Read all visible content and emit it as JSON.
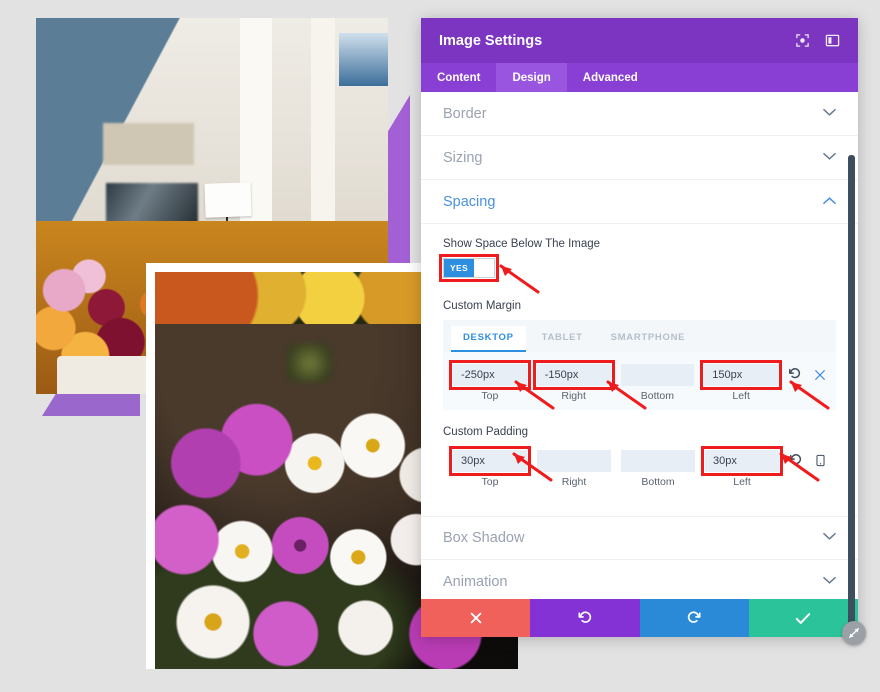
{
  "page": {
    "background_color": "#e2e2e2"
  },
  "canvas": {
    "images": [
      {
        "name": "flower-market-photo",
        "alt": "Blurred flower market stall with orange, yellow and magenta blooms",
        "accent_color": "#a35fd4"
      },
      {
        "name": "cosmos-bouquet-photo",
        "alt": "Close-up of purple and white cosmos flowers on a dark background",
        "border_color": "#ffffff"
      }
    ]
  },
  "modal": {
    "title": "Image Settings",
    "header_icons": [
      {
        "name": "target-focus-icon"
      },
      {
        "name": "layout-panel-icon"
      }
    ],
    "tabs": [
      {
        "label": "Content",
        "active": false
      },
      {
        "label": "Design",
        "active": true
      },
      {
        "label": "Advanced",
        "active": false
      }
    ],
    "sections": [
      {
        "label": "Border",
        "open": false,
        "chevron": "down"
      },
      {
        "label": "Sizing",
        "open": false,
        "chevron": "down"
      },
      {
        "label": "Spacing",
        "open": true,
        "chevron": "up"
      },
      {
        "label": "Box Shadow",
        "open": false,
        "chevron": "down"
      },
      {
        "label": "Animation",
        "open": false,
        "chevron": "down"
      }
    ],
    "spacing": {
      "show_space_label": "Show Space Below The Image",
      "toggle": {
        "value": "YES",
        "on": true,
        "highlighted": true
      },
      "custom_margin_label": "Custom Margin",
      "custom_padding_label": "Custom Padding",
      "device_tabs": [
        {
          "label": "DESKTOP",
          "active": true
        },
        {
          "label": "TABLET",
          "active": false
        },
        {
          "label": "SMARTPHONE",
          "active": false
        }
      ],
      "margin": {
        "fields": [
          {
            "caption": "Top",
            "value": "-250px",
            "highlighted": true
          },
          {
            "caption": "Right",
            "value": "-150px",
            "highlighted": true
          },
          {
            "caption": "Bottom",
            "value": "",
            "highlighted": false
          },
          {
            "caption": "Left",
            "value": "150px",
            "highlighted": true
          }
        ],
        "icons": [
          {
            "name": "reset-icon"
          },
          {
            "name": "close-icon"
          }
        ]
      },
      "padding": {
        "fields": [
          {
            "caption": "Top",
            "value": "30px",
            "highlighted": true
          },
          {
            "caption": "Right",
            "value": "",
            "highlighted": false
          },
          {
            "caption": "Bottom",
            "value": "",
            "highlighted": false
          },
          {
            "caption": "Left",
            "value": "30px",
            "highlighted": true
          }
        ],
        "icons": [
          {
            "name": "reset-icon"
          },
          {
            "name": "mobile-device-icon"
          }
        ]
      }
    },
    "footer_buttons": [
      {
        "name": "cancel-button",
        "icon": "close-icon",
        "color": "#f0615c"
      },
      {
        "name": "undo-button",
        "icon": "undo-icon",
        "color": "#8431d6"
      },
      {
        "name": "redo-button",
        "icon": "redo-icon",
        "color": "#2b8ad8"
      },
      {
        "name": "save-button",
        "icon": "check-icon",
        "color": "#2bc49a"
      }
    ],
    "colors": {
      "header": "#7b35c1",
      "tabbar": "#8a3fd4",
      "tab_active": "#9a55e0",
      "section_open_text": "#4a90e2",
      "highlight": "#ee1c1c"
    }
  },
  "annotations": {
    "arrow_color": "#ee1c1c",
    "arrows": [
      {
        "name": "arrow-to-toggle"
      },
      {
        "name": "arrow-to-margin-top"
      },
      {
        "name": "arrow-to-margin-right"
      },
      {
        "name": "arrow-to-margin-left"
      },
      {
        "name": "arrow-to-padding-top"
      },
      {
        "name": "arrow-to-padding-left"
      }
    ]
  },
  "resize_handle": {
    "name": "resize-handle"
  }
}
